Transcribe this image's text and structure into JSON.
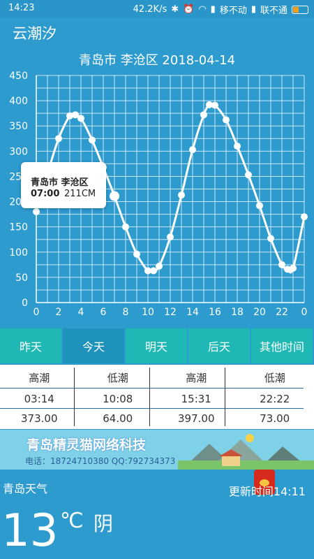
{
  "status_bar": {
    "time": "14:23",
    "net_speed": "42.2K/s",
    "carrier1": "移不动",
    "carrier2": "联不通"
  },
  "app": {
    "title": "云潮汐"
  },
  "chart": {
    "title": "青岛市 李沧区 2018-04-14"
  },
  "chart_data": {
    "type": "line",
    "title": "青岛市 李沧区 2018-04-14",
    "x": [
      0,
      1,
      2,
      3,
      3.5,
      4,
      5,
      6,
      7,
      8,
      9,
      10,
      10.5,
      11,
      12,
      13,
      14,
      15,
      15.5,
      16,
      17,
      18,
      19,
      20,
      21,
      22,
      22.5,
      23,
      24
    ],
    "values": [
      180,
      255,
      325,
      370,
      372,
      365,
      322,
      268,
      211,
      150,
      96,
      63,
      63,
      72,
      130,
      213,
      303,
      372,
      392,
      391,
      362,
      310,
      253,
      192,
      127,
      75,
      66,
      68,
      170
    ],
    "x_ticks": [
      "0",
      "2",
      "4",
      "6",
      "8",
      "10",
      "12",
      "14",
      "16",
      "18",
      "20",
      "22",
      "0"
    ],
    "y_ticks": [
      "0",
      "50",
      "100",
      "150",
      "200",
      "250",
      "300",
      "350",
      "400",
      "450"
    ],
    "ylim": [
      0,
      450
    ],
    "grid": true,
    "highlight": {
      "location": "青岛市 李沧区",
      "time": "07:00",
      "value": "211CM"
    }
  },
  "tabs": [
    "昨天",
    "今天",
    "明天",
    "后天",
    "其他时间"
  ],
  "active_tab": "今天",
  "tide_table": {
    "headers": [
      "高潮",
      "低潮",
      "高潮",
      "低潮"
    ],
    "times": [
      "03:14",
      "10:08",
      "15:31",
      "22:22"
    ],
    "heights": [
      "373.00",
      "64.00",
      "397.00",
      "73.00"
    ]
  },
  "banner": {
    "company": "青岛精灵猫网络科技",
    "contact": "电话：18724710380 QQ:792734373"
  },
  "weather": {
    "city": "青岛天气",
    "update": "更新时间14:11",
    "temp": "13",
    "unit": "℃",
    "condition": "阴"
  },
  "colors": {
    "background": "#2e9bcf",
    "tab": "#1fb8b4",
    "tab_active": "#1f92bc"
  }
}
